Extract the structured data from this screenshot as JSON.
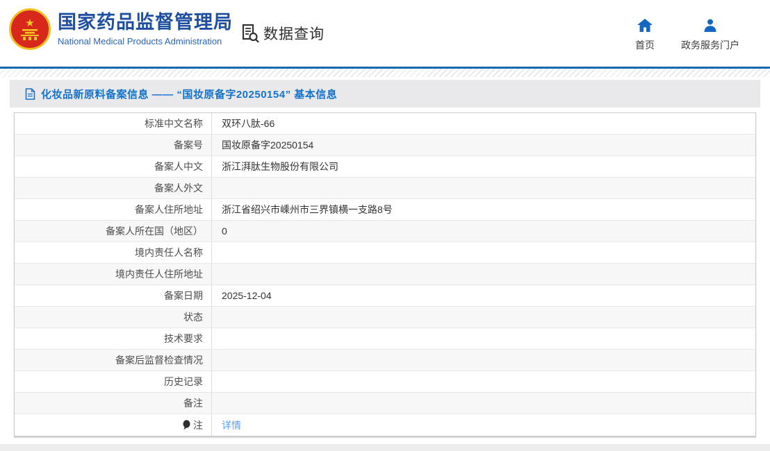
{
  "header": {
    "org_name_zh": "国家药品监督管理局",
    "org_name_en": "National Medical Products Administration",
    "data_query_label": "数据查询",
    "nav": {
      "home_label": "首页",
      "portal_label": "政务服务门户"
    }
  },
  "page": {
    "title": "化妆品新原料备案信息 —— “国妆原备字20250154” 基本信息"
  },
  "table": {
    "rows": [
      {
        "label": "标准中文名称",
        "value": "双环八肽-66"
      },
      {
        "label": "备案号",
        "value": "国妆原备字20250154"
      },
      {
        "label": "备案人中文",
        "value": "浙江湃肽生物股份有限公司"
      },
      {
        "label": "备案人外文",
        "value": ""
      },
      {
        "label": "备案人住所地址",
        "value": "浙江省绍兴市嵊州市三界镇横一支路8号"
      },
      {
        "label": "备案人所在国（地区）",
        "value": "0"
      },
      {
        "label": "境内责任人名称",
        "value": ""
      },
      {
        "label": "境内责任人住所地址",
        "value": ""
      },
      {
        "label": "备案日期",
        "value": "2025-12-04"
      },
      {
        "label": "状态",
        "value": ""
      },
      {
        "label": "技术要求",
        "value": ""
      },
      {
        "label": "备案后监督检查情况",
        "value": ""
      },
      {
        "label": "历史记录",
        "value": ""
      },
      {
        "label": "备注",
        "value": ""
      },
      {
        "label": "注",
        "value": "详情"
      }
    ]
  },
  "colors": {
    "brand_blue": "#1e4fa0",
    "divider_blue": "#1368ae",
    "icon_blue": "#1468c3",
    "title_blue": "#1573cc",
    "link_blue": "#5e9ef7",
    "emblem_red": "#d8281c",
    "emblem_gold": "#efc020"
  }
}
